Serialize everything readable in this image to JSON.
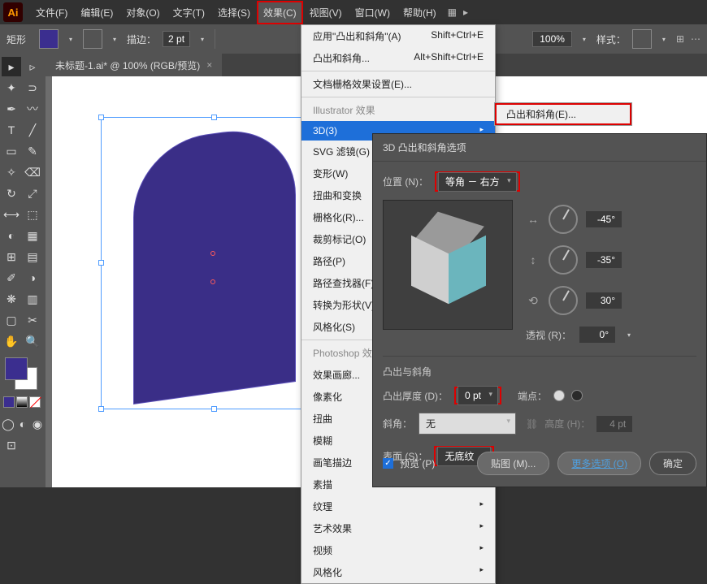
{
  "app": {
    "logo": "Ai"
  },
  "menu": {
    "file": "文件(F)",
    "edit": "编辑(E)",
    "object": "对象(O)",
    "type": "文字(T)",
    "select": "选择(S)",
    "effect": "效果(C)",
    "view": "视图(V)",
    "window": "窗口(W)",
    "help": "帮助(H)"
  },
  "control": {
    "shape": "矩形",
    "stroke_label": "描边：",
    "stroke": "2 pt",
    "zoom": "100%",
    "style_label": "样式："
  },
  "doc": {
    "tab": "未标题-1.ai* @ 100% (RGB/预览)"
  },
  "effect_menu": {
    "apply": "应用\"凸出和斜角\"(A)",
    "apply_sc": "Shift+Ctrl+E",
    "last": "凸出和斜角...",
    "last_sc": "Alt+Shift+Ctrl+E",
    "grid": "文档栅格效果设置(E)...",
    "illus": "Illustrator 效果",
    "d3": "3D(3)",
    "svg": "SVG 滤镜(G)",
    "warp": "变形(W)",
    "distort": "扭曲和变换",
    "raster": "栅格化(R)...",
    "crop": "裁剪标记(O)",
    "path": "路径(P)",
    "pathfinder": "路径查找器(F)",
    "convert": "转换为形状(V)",
    "stylize": "风格化(S)",
    "ps": "Photoshop 效果",
    "gallery": "效果画廊...",
    "pixelate": "像素化",
    "twist": "扭曲",
    "blur": "模糊",
    "brush": "画笔描边",
    "sketch": "素描",
    "texture": "纹理",
    "artistic": "艺术效果",
    "video": "视频",
    "styl2": "风格化"
  },
  "submenu": {
    "extrude": "凸出和斜角(E)..."
  },
  "dialog": {
    "title": "3D 凸出和斜角选项",
    "pos_label": "位置 (N)：",
    "pos_value": "等角 － 右方",
    "angles": {
      "x": "-45°",
      "y": "-35°",
      "z": "30°"
    },
    "persp_label": "透视 (R)：",
    "persp_value": "0°",
    "section": "凸出与斜角",
    "depth_label": "凸出厚度 (D)：",
    "depth_value": "0 pt",
    "cap_label": "端点：",
    "bevel_label": "斜角：",
    "bevel_value": "无",
    "height_label": "高度 (H)：",
    "height_value": "4 pt",
    "surface_label": "表面 (S)：",
    "surface_value": "无底纹",
    "preview": "预览 (P)",
    "map": "贴图 (M)...",
    "more": "更多选项 (O)",
    "ok": "确定"
  }
}
